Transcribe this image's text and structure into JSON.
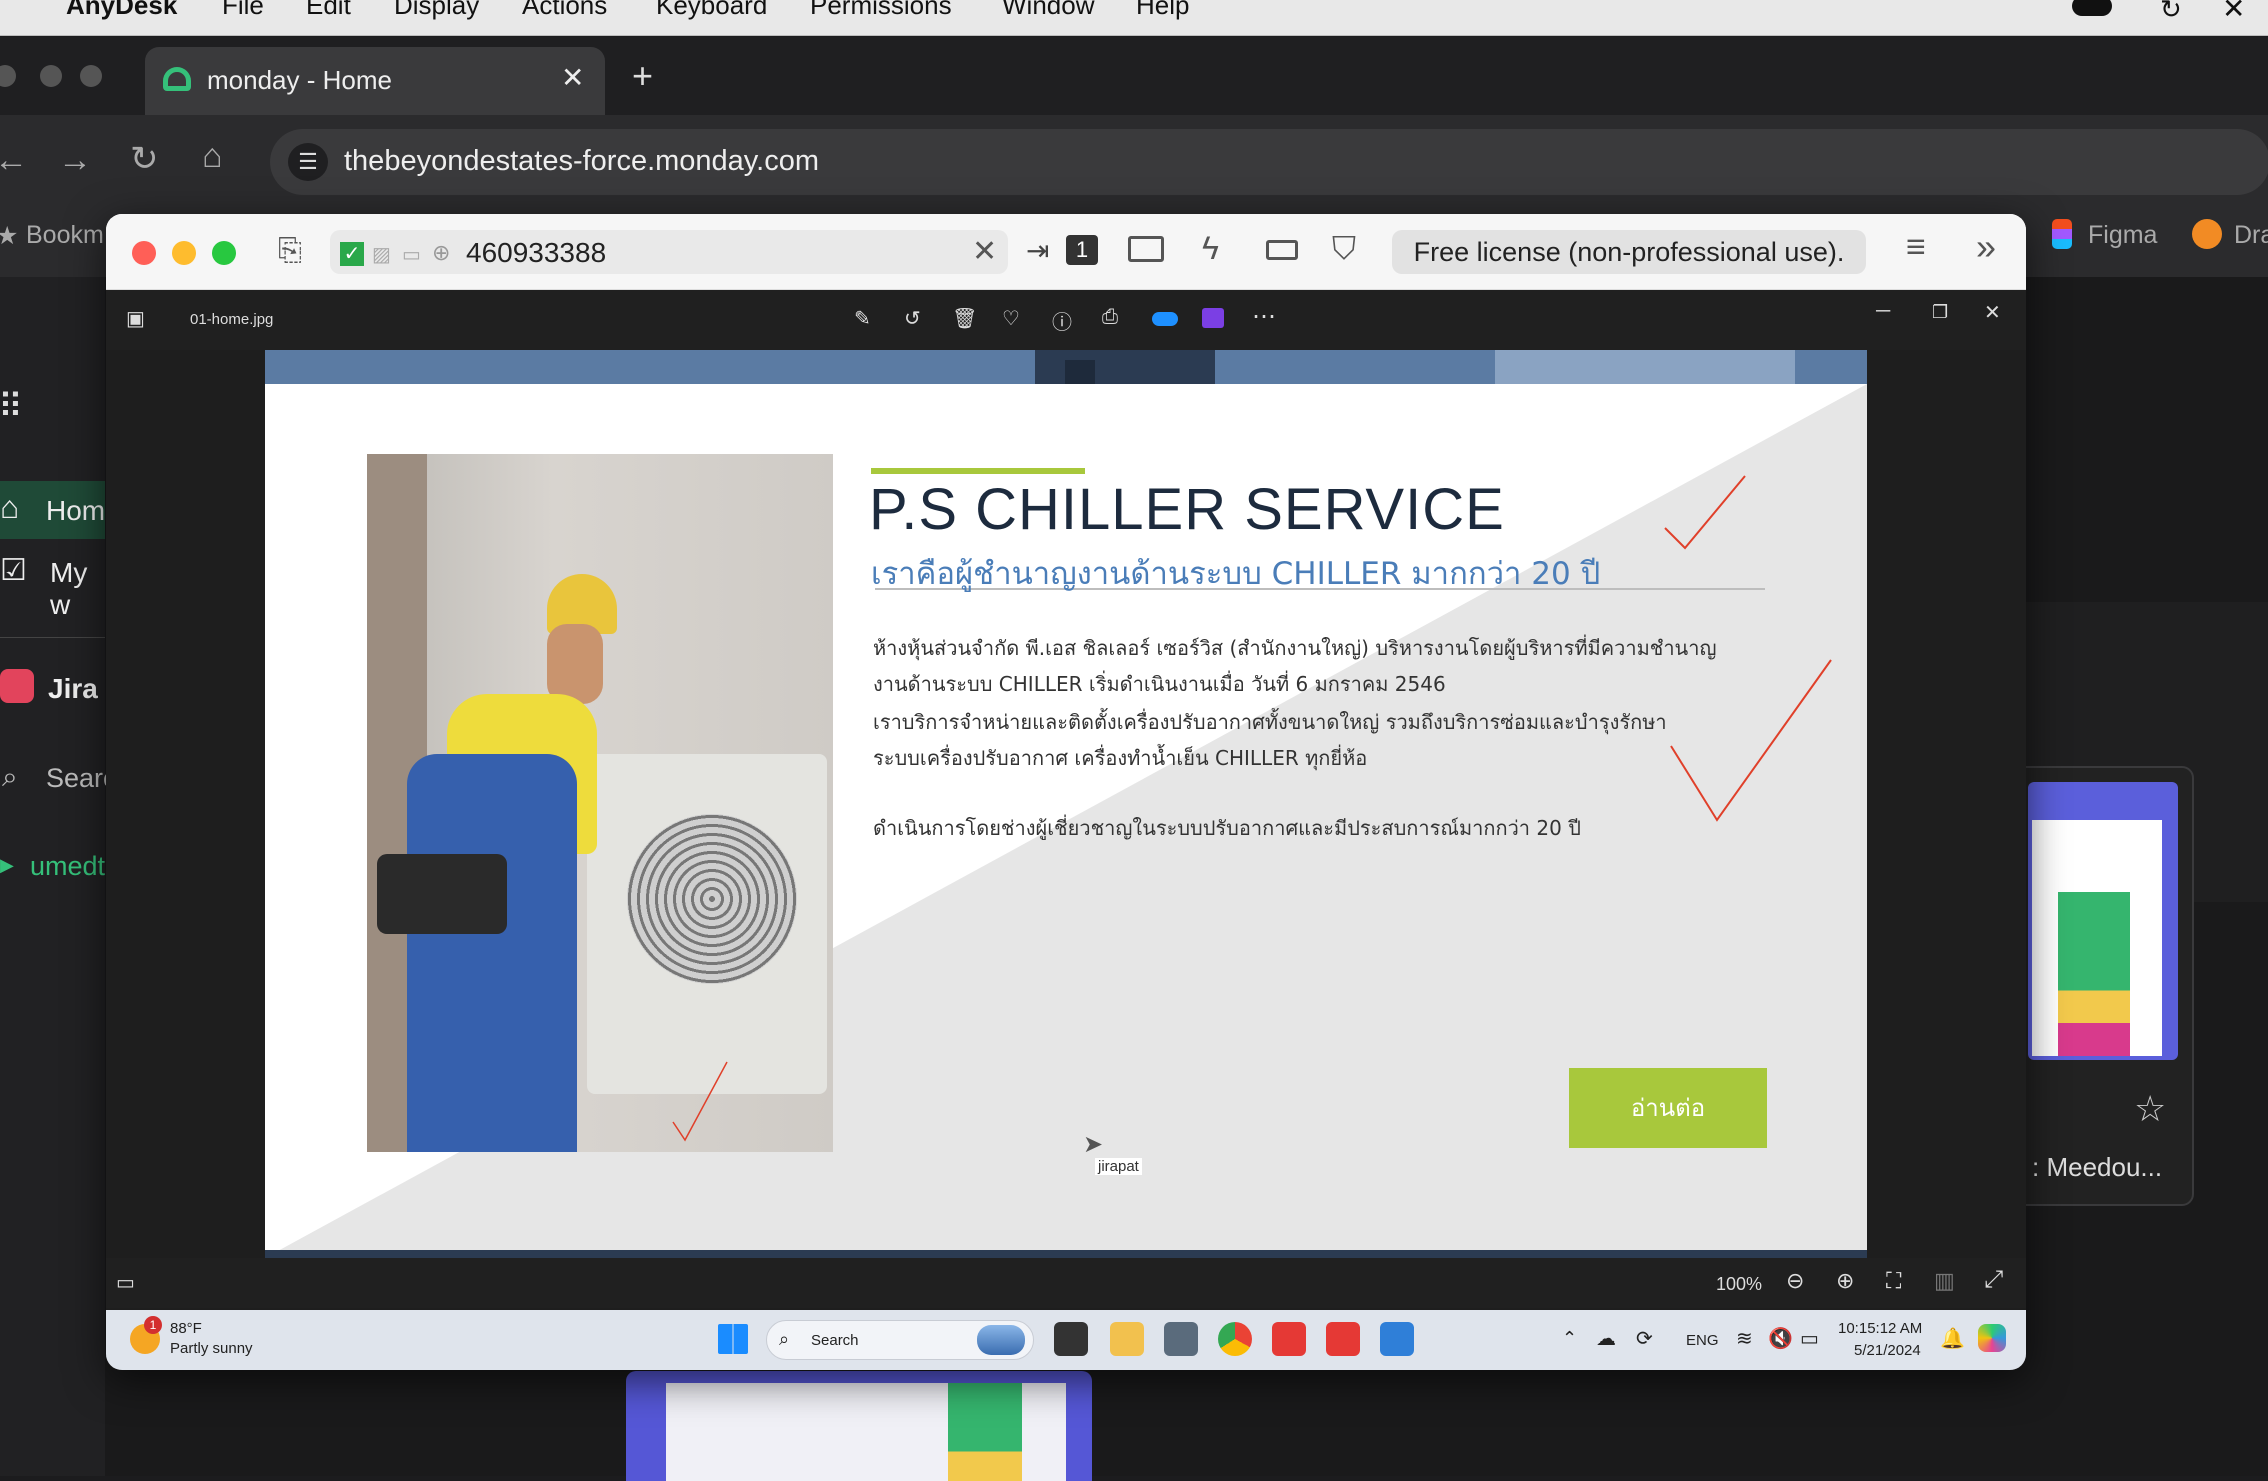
{
  "menubar": {
    "app": "AnyDesk",
    "items": [
      "File",
      "Edit",
      "Display",
      "Actions",
      "Keyboard",
      "Permissions",
      "Window",
      "Help"
    ]
  },
  "browser": {
    "tab_title": "monday - Home",
    "url": "thebeyondestates-force.monday.com",
    "bookmarks_label": "Bookm",
    "bookmark_figma": "Figma",
    "bookmark_dr": "Dra"
  },
  "monday": {
    "nav_home": "Hom",
    "nav_mywork": "My w",
    "workspace": "Jira",
    "search": "Searc",
    "folder": "umedt",
    "card_title": ": Meedou..."
  },
  "anydesk": {
    "remote_id": "460933388",
    "license": "Free license (non-professional use).",
    "display_number": "1"
  },
  "viewer": {
    "filename": "01-home.jpg",
    "zoom": "100%"
  },
  "slide": {
    "title": "P.S CHILLER SERVICE",
    "subtitle": "เราคือผู้ชำนาญงานด้านระบบ CHILLER มากกว่า 20 ปี",
    "para1_line1": "ห้างหุ้นส่วนจำกัด พี.เอส ชิลเลอร์ เซอร์วิส (สำนักงานใหญ่) บริหารงานโดยผู้บริหารที่มีความชำนาญ",
    "para1_line2": "งานด้านระบบ CHILLER  เริ่มดำเนินงานเมื่อ วันที่ 6 มกราคม 2546",
    "para2_line1": "เราบริการจำหน่ายและติดตั้งเครื่องปรับอากาศทั้งขนาดใหญ่ รวมถึงบริการซ่อมและบำรุงรักษา",
    "para2_line2": "ระบบเครื่องปรับอากาศ เครื่องทำน้ำเย็น CHILLER ทุกยี่ห้อ",
    "para3": "ดำเนินการโดยช่างผู้เชี่ยวชาญในระบบปรับอากาศและมีประสบการณ์มากกว่า 20 ปี",
    "button": "อ่านต่อ",
    "cursor_label": "jirapat"
  },
  "taskbar": {
    "weather_temp": "88°F",
    "weather_desc": "Partly sunny",
    "weather_badge": "1",
    "search": "Search",
    "lang": "ENG",
    "time": "10:15:12 AM",
    "date": "5/21/2024"
  },
  "colors": {
    "accent_green": "#a8c83c",
    "subtitle_blue": "#4a7db8",
    "annotation_red": "#e0402a"
  }
}
